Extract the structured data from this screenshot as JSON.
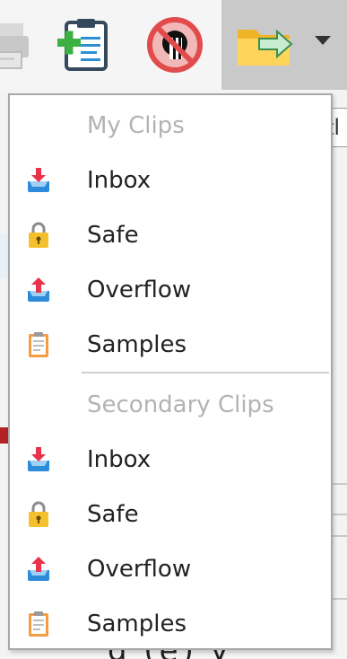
{
  "menu": {
    "sections": [
      {
        "header": "My Clips",
        "items": [
          {
            "label": "Inbox",
            "icon": "inbox-download-icon"
          },
          {
            "label": "Safe",
            "icon": "padlock-icon"
          },
          {
            "label": "Overflow",
            "icon": "inbox-upload-icon"
          },
          {
            "label": "Samples",
            "icon": "clipboard-icon"
          }
        ]
      },
      {
        "header": "Secondary Clips",
        "items": [
          {
            "label": "Inbox",
            "icon": "inbox-download-icon"
          },
          {
            "label": "Safe",
            "icon": "padlock-icon"
          },
          {
            "label": "Overflow",
            "icon": "inbox-upload-icon"
          },
          {
            "label": "Samples",
            "icon": "clipboard-icon"
          }
        ]
      }
    ]
  },
  "toolbar": {
    "buttons": [
      {
        "icon": "printer-icon"
      },
      {
        "icon": "new-clip-icon"
      },
      {
        "icon": "no-image-icon"
      },
      {
        "icon": "move-to-folder-icon",
        "has_dropdown": true
      }
    ]
  },
  "background": {
    "field_fragment": "tl",
    "bottom_fragment": "g (e) y"
  },
  "colors": {
    "menu_header": "#b3b3b3",
    "menu_text": "#222222",
    "toolbar_active": "#c9c9c9",
    "menu_border": "#a8a8a8"
  }
}
